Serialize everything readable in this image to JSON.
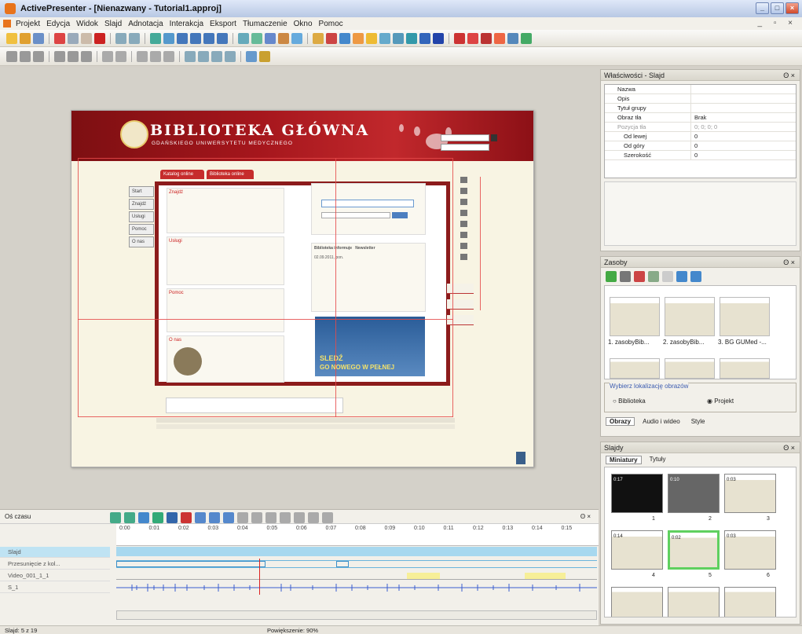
{
  "window": {
    "title": "ActivePresenter - [Nienazwany - Tutorial1.approj]"
  },
  "menu": [
    "Projekt",
    "Edycja",
    "Widok",
    "Slajd",
    "Adnotacja",
    "Interakcja",
    "Eksport",
    "Tłumaczenie",
    "Okno",
    "Pomoc"
  ],
  "slide": {
    "title": "BIBLIOTEKA GŁÓWNA",
    "subtitle": "GDAŃSKIEGO UNIWERSYTETU MEDYCZNEGO",
    "tabs": [
      "Katalog online",
      "Biblioteka online"
    ],
    "nav": [
      "Start",
      "Znajdź",
      "Usługi",
      "Pomoc",
      "O nas"
    ],
    "sections": [
      "Znajdź",
      "Usługi",
      "Pomoc",
      "O nas"
    ],
    "news_heading": "Biblioteka informuje",
    "newsletter": "Newsletter",
    "news_date": "02.09.2011, pon.",
    "promo1": "SLEDŹ",
    "promo2": "GO NOWEGO W PEŁNEJ"
  },
  "properties": {
    "title": "Właściwości - Slajd",
    "rows": [
      {
        "k": "Nazwa",
        "v": ""
      },
      {
        "k": "Opis",
        "v": ""
      },
      {
        "k": "Tytuł grupy",
        "v": ""
      },
      {
        "k": "Obraz tła",
        "v": "Brak"
      },
      {
        "k": "Pozycja tła",
        "v": "0; 0; 0; 0"
      },
      {
        "k": "Od lewej",
        "v": "0"
      },
      {
        "k": "Od góry",
        "v": "0"
      },
      {
        "k": "Szerokość",
        "v": "0"
      }
    ]
  },
  "resources": {
    "title": "Zasoby",
    "items": [
      "1. zasobyBib...",
      "2. zasobyBib...",
      "3. BG GUMed -..."
    ],
    "location_label": "Wybierz lokalizację obrazów",
    "radio1": "Biblioteka",
    "radio2": "Projekt",
    "tabs": [
      "Obrazy",
      "Audio i wideo",
      "Style"
    ]
  },
  "slides": {
    "title": "Slajdy",
    "tabs": [
      "Miniatury",
      "Tytuły"
    ],
    "numbers": [
      "1",
      "2",
      "3",
      "4",
      "5",
      "6"
    ],
    "durations": [
      "0:17",
      "0:10",
      "0:03",
      "0:14",
      "0:02",
      "0:03"
    ]
  },
  "timeline": {
    "title": "Oś czasu",
    "ticks": [
      "0:00",
      "0:01",
      "0:02",
      "0:03",
      "0:04",
      "0:05",
      "0:06",
      "0:07",
      "0:08",
      "0:09",
      "0:10",
      "0:11",
      "0:12",
      "0:13",
      "0:14",
      "0:15"
    ],
    "rows": [
      "Slajd",
      "Przesunięcie z kol...",
      "Video_001_1_1",
      "S_1"
    ]
  },
  "status": {
    "slide": "Slajd: 5 z 19",
    "zoom": "Powiększenie: 90%"
  },
  "colors": {
    "accent": "#a5161c",
    "timeline_bar": "#a7d8ef"
  }
}
